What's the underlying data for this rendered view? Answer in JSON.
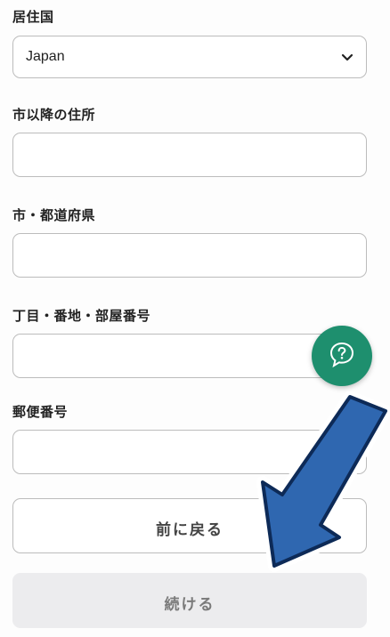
{
  "form": {
    "country_label": "居住国",
    "country_value": "Japan",
    "address_line_label": "市以降の住所",
    "address_line_value": "",
    "city_prefecture_label": "市・都道府県",
    "city_prefecture_value": "",
    "block_building_label": "丁目・番地・部屋番号",
    "block_building_value": "",
    "postal_code_label": "郵便番号",
    "postal_code_value": ""
  },
  "buttons": {
    "back_label": "前に戻る",
    "continue_label": "続ける"
  },
  "icons": {
    "help": "help-chat-icon",
    "chevron": "chevron-down-icon",
    "arrow": "pointer-arrow-icon"
  },
  "colors": {
    "help_fab": "#1e8f6e",
    "arrow_fill": "#2f67b0",
    "arrow_outline": "#0d2a57",
    "continue_bg": "#ececee"
  }
}
